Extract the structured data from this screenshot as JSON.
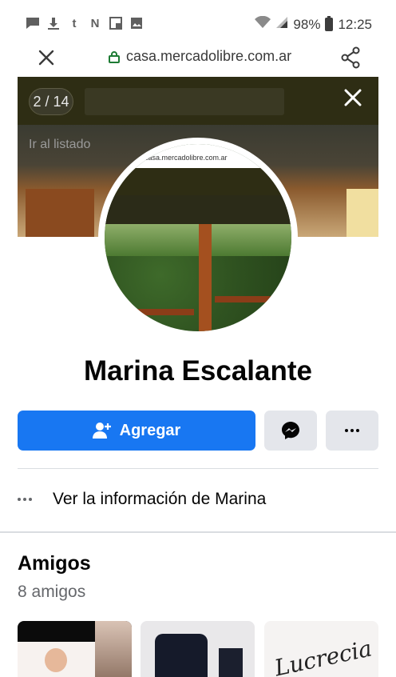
{
  "status_bar": {
    "left_icons": [
      "message-icon",
      "download-icon",
      "tumblr-icon",
      "netflix-icon",
      "gallery-icon",
      "image-icon"
    ],
    "battery": "98%",
    "time": "12:25"
  },
  "url_bar": {
    "url": "casa.mercadolibre.com.ar"
  },
  "cover": {
    "counter": "2 / 14",
    "back_text": "Ir al listado"
  },
  "avatar": {
    "url_text": "casa.mercadolibre.com.ar",
    "counter": "14",
    "back_text": "Ir al listado"
  },
  "profile": {
    "name": "Marina Escalante"
  },
  "actions": {
    "add_label": "Agregar"
  },
  "info": {
    "label": "Ver la información de Marina"
  },
  "friends": {
    "title": "Amigos",
    "count": "8 amigos",
    "card3_text": "Lucrecia"
  },
  "colors": {
    "accent": "#1877f2",
    "secondary_button": "#e4e6eb"
  }
}
